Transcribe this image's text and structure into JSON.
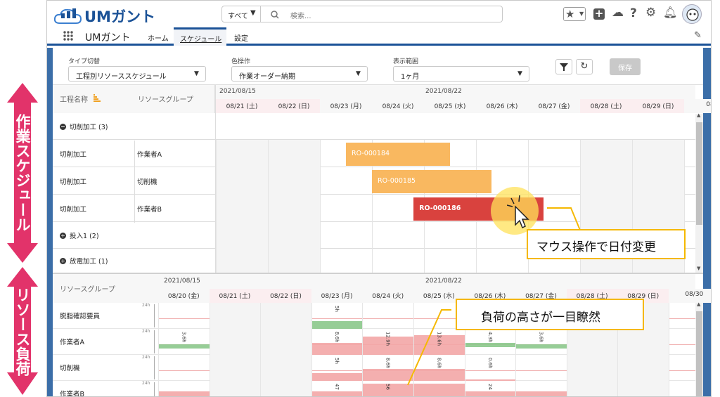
{
  "app": {
    "logo": "UMガント"
  },
  "search": {
    "scope": "すべて",
    "placeholder": "検索..."
  },
  "nav": {
    "app_name": "UMガント",
    "tabs": [
      "ホーム",
      "スケジュール",
      "設定"
    ]
  },
  "filters": {
    "type_label": "タイプ切替",
    "type_value": "工程別リソーススケジュール",
    "color_label": "色操作",
    "color_value": "作業オーダー納期",
    "range_label": "表示範囲",
    "range_value": "1ヶ月",
    "save_label": "保存"
  },
  "gantt": {
    "col_process": "工程名称",
    "col_group": "リソースグループ",
    "date_start": "2021/08/15",
    "date_week": "2021/08/22",
    "days": [
      "08/21 (土)",
      "08/22 (日)",
      "08/23 (月)",
      "08/24 (火)",
      "08/25 (水)",
      "08/26 (木)",
      "08/27 (金)",
      "08/28 (土)",
      "08/29 (日)",
      "08"
    ],
    "group1": "切削加工 (3)",
    "rows": [
      {
        "process": "切削加工",
        "group": "作業者A"
      },
      {
        "process": "切削加工",
        "group": "切削機"
      },
      {
        "process": "切削加工",
        "group": "作業者B"
      }
    ],
    "group2": "投入1 (2)",
    "group3": "放電加工 (1)",
    "bars": [
      {
        "label": "RO-000184",
        "start_day": 2.5,
        "end_day": 4.5,
        "color": "#f9b860"
      },
      {
        "label": "RO-000185",
        "start_day": 3.0,
        "end_day": 5.3,
        "color": "#f9b860"
      },
      {
        "label": "RO-000186",
        "start_day": 3.8,
        "end_day": 6.3,
        "color": "#d9423e"
      }
    ]
  },
  "load": {
    "col_group": "リソースグループ",
    "date_start": "2021/08/15",
    "date_week": "2021/08/22",
    "days": [
      "08/20 (金)",
      "08/21 (土)",
      "08/22 (日)",
      "08/23 (月)",
      "08/24 (火)",
      "08/25 (水)",
      "08/26 (木)",
      "08/27 (金)",
      "08/28 (土)",
      "08/29 (日)",
      "08/30"
    ],
    "axis_label": "24h",
    "rows": [
      {
        "name": "脱脂確認要員",
        "values": [
          "",
          "",
          "",
          "5h",
          "",
          "",
          "",
          "",
          "",
          "",
          ""
        ]
      },
      {
        "name": "作業者A",
        "values": [
          "3.6h",
          "",
          "",
          "8.6h",
          "12.9h",
          "13.6h",
          "4.3h",
          "3.6h",
          "",
          "",
          ""
        ]
      },
      {
        "name": "切削機",
        "values": [
          "",
          "",
          "",
          "5h",
          "8.6h",
          "8.6h",
          "0.6h",
          "",
          "",
          "",
          ""
        ]
      },
      {
        "name": "作業者B",
        "values": [
          "",
          "",
          "",
          "47",
          "56",
          "",
          "24",
          "",
          "",
          "",
          ""
        ]
      }
    ]
  },
  "annotations": {
    "left_top": "作業スケジュール",
    "left_bottom": "リソース負荷",
    "callout1": "マウス操作で日付変更",
    "callout2": "負荷の高さが一目瞭然"
  },
  "colors": {
    "brand": "#1b5297",
    "accent": "#e2336a",
    "orange": "#f9b860",
    "red": "#d9423e",
    "pink": "#f3a6a6",
    "green": "#8bc88b",
    "callout": "#f5b800"
  }
}
